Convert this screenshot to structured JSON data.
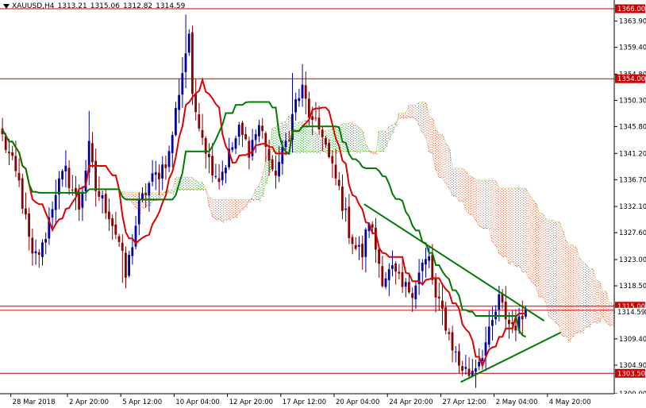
{
  "header": {
    "symbol": "XAUUSD,H4",
    "open": "1313.21",
    "high": "1315.06",
    "low": "1312.82",
    "close": "1314.59"
  },
  "colors": {
    "bull": "#0000a0",
    "bear": "#8b0000",
    "tenkan": "#e00000",
    "kijun": "#007a00",
    "kumo_bull": "#009000",
    "kumo_bear": "#e04010",
    "hline": "#cc0000",
    "trend": "#007a00",
    "badge_bg": "#cc0000"
  },
  "chart_data": {
    "type": "candlestick",
    "instrument": "XAUUSD",
    "timeframe": "H4",
    "ylim": [
      1300.0,
      1367.5
    ],
    "y_ticks": [
      "1363.90",
      "1359.40",
      "1354.80",
      "1350.30",
      "1345.80",
      "1341.20",
      "1336.70",
      "1332.10",
      "1327.60",
      "1323.00",
      "1318.50",
      "1314.00",
      "1309.40",
      "1304.90",
      "1300.00"
    ],
    "x_ticks": [
      {
        "label": "28 Mar 2018",
        "bar": 3
      },
      {
        "label": "2 Apr 20:00",
        "bar": 20
      },
      {
        "label": "5 Apr 12:00",
        "bar": 36
      },
      {
        "label": "10 Apr 04:00",
        "bar": 52
      },
      {
        "label": "12 Apr 20:00",
        "bar": 68
      },
      {
        "label": "17 Apr 12:00",
        "bar": 84
      },
      {
        "label": "20 Apr 04:00",
        "bar": 100
      },
      {
        "label": "24 Apr 20:00",
        "bar": 116
      },
      {
        "label": "27 Apr 12:00",
        "bar": 132
      },
      {
        "label": "2 May 04:00",
        "bar": 148
      },
      {
        "label": "4 May 20:00",
        "bar": 164
      }
    ],
    "horizontal_levels": [
      {
        "value": 1366.0,
        "label": "1366.00"
      },
      {
        "value": 1354.0,
        "label": "1354.00"
      },
      {
        "value": 1315.0,
        "label": "1315.00"
      },
      {
        "value": 1314.3,
        "label": ""
      },
      {
        "value": 1303.5,
        "label": "1303.50"
      }
    ],
    "current_price": "1314.59",
    "trendlines": [
      {
        "from": {
          "bar": 109,
          "price": 1332.5
        },
        "to": {
          "bar": 163,
          "price": 1312.5
        }
      },
      {
        "from": {
          "bar": 138,
          "price": 1302.0
        },
        "to": {
          "bar": 168,
          "price": 1310.5
        }
      }
    ],
    "kumo_shift": 26,
    "close_path": [
      [
        0,
        1344
      ],
      [
        5,
        1336
      ],
      [
        9,
        1323
      ],
      [
        12,
        1325
      ],
      [
        16,
        1335
      ],
      [
        19,
        1338
      ],
      [
        23,
        1332
      ],
      [
        26,
        1342
      ],
      [
        28,
        1335
      ],
      [
        32,
        1331
      ],
      [
        35,
        1326
      ],
      [
        37,
        1320
      ],
      [
        41,
        1332
      ],
      [
        44,
        1336
      ],
      [
        47,
        1338
      ],
      [
        50,
        1341
      ],
      [
        53,
        1352
      ],
      [
        56,
        1362
      ],
      [
        57,
        1350
      ],
      [
        59,
        1347
      ],
      [
        62,
        1340
      ],
      [
        65,
        1337
      ],
      [
        68,
        1341
      ],
      [
        71,
        1345
      ],
      [
        74,
        1342
      ],
      [
        77,
        1346
      ],
      [
        79,
        1343
      ],
      [
        81,
        1337
      ],
      [
        84,
        1341
      ],
      [
        86,
        1345
      ],
      [
        88,
        1350
      ],
      [
        90,
        1352
      ],
      [
        93,
        1346
      ],
      [
        96,
        1345
      ],
      [
        98,
        1340
      ],
      [
        101,
        1335
      ],
      [
        104,
        1328
      ],
      [
        106,
        1325
      ],
      [
        108,
        1324
      ],
      [
        110,
        1330
      ],
      [
        112,
        1325
      ],
      [
        114,
        1320
      ],
      [
        117,
        1321
      ],
      [
        120,
        1318
      ],
      [
        123,
        1318
      ],
      [
        126,
        1322
      ],
      [
        128,
        1323
      ],
      [
        130,
        1316
      ],
      [
        132,
        1314
      ],
      [
        134,
        1310
      ],
      [
        137,
        1305
      ],
      [
        140,
        1303.5
      ],
      [
        143,
        1306
      ],
      [
        146,
        1310
      ],
      [
        149,
        1316
      ],
      [
        152,
        1312
      ],
      [
        155,
        1312
      ],
      [
        157,
        1314.5
      ]
    ],
    "series": [
      {
        "name": "Tenkan-sen",
        "role": "tenkan"
      },
      {
        "name": "Kijun-sen",
        "role": "kijun"
      },
      {
        "name": "Senkou Span A",
        "role": "span_a"
      },
      {
        "name": "Senkou Span B",
        "role": "span_b"
      }
    ]
  }
}
